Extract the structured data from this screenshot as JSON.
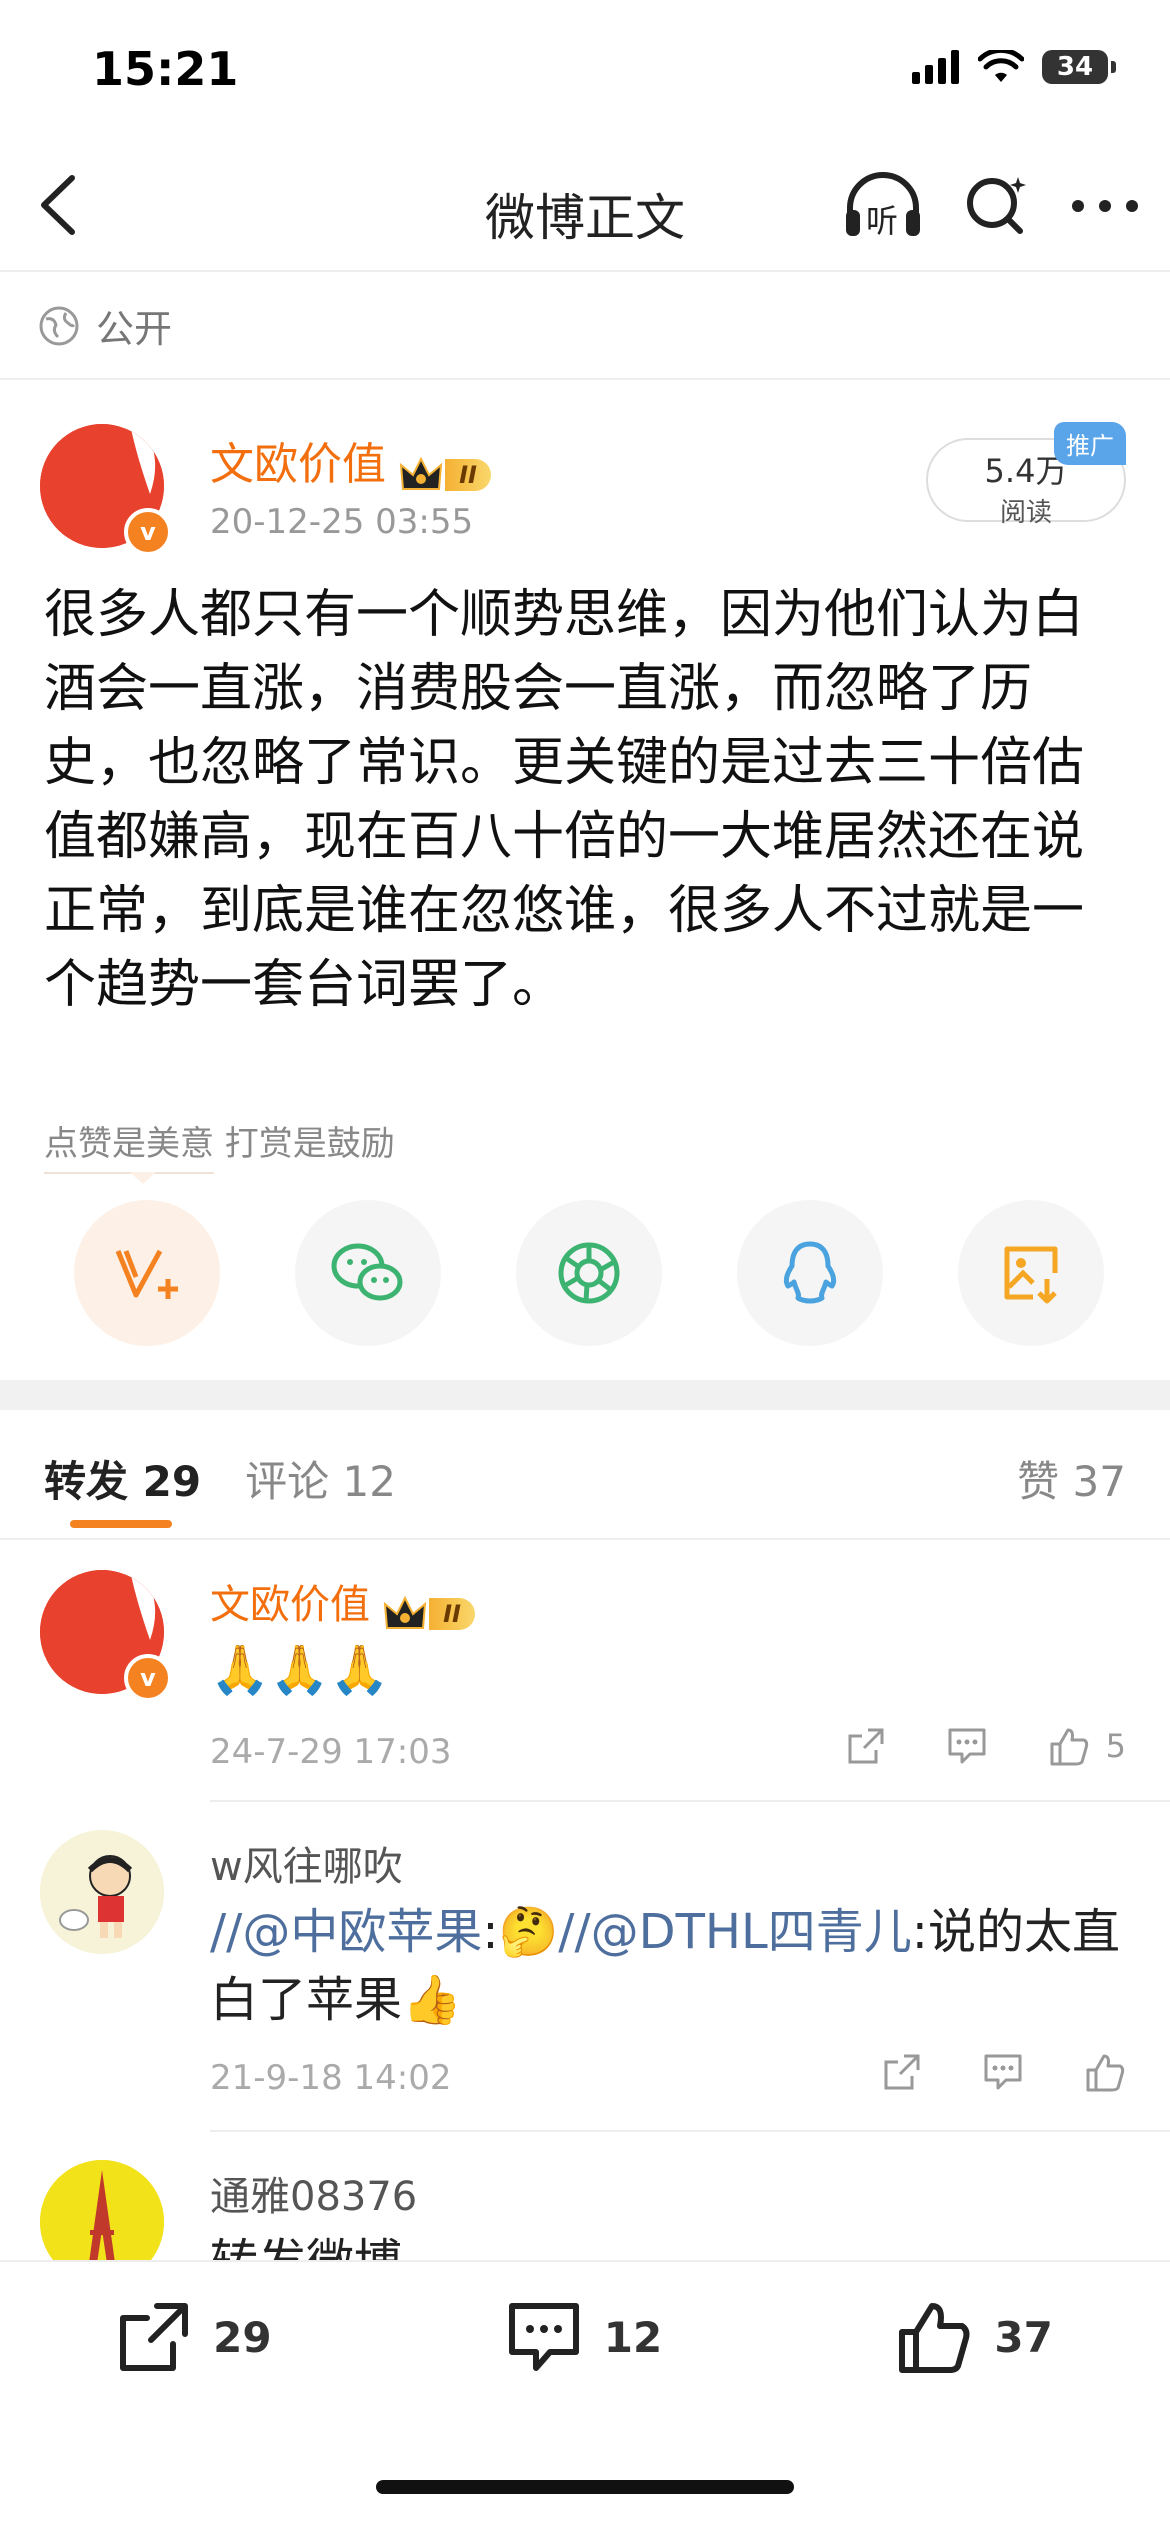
{
  "status": {
    "time": "15:21",
    "battery": "34"
  },
  "nav": {
    "title": "微博正文",
    "listen_label": "听"
  },
  "visibility": "公开",
  "post": {
    "author": "文欧价值",
    "level": "II",
    "timestamp": "20-12-25 03:55",
    "reads_count": "5.4万",
    "reads_label": "阅读",
    "promo_badge": "推广",
    "text": "很多人都只有一个顺势思维，因为他们认为白酒会一直涨，消费股会一直涨，而忽略了历史，也忽略了常识。更关键的是过去三十倍估值都嫌高，现在百八十倍的一大堆居然还在说正常，到底是谁在忽悠谁，很多人不过就是一个趋势一套台词罢了。"
  },
  "tip_text": "点赞是美意  打赏是鼓励",
  "share_icons": [
    "v-plus-reward-icon",
    "wechat-icon",
    "moments-icon",
    "qq-icon",
    "save-image-icon"
  ],
  "tabs": {
    "repost": {
      "label": "转发",
      "count": "29"
    },
    "comment": {
      "label": "评论",
      "count": "12"
    },
    "like": {
      "label": "赞",
      "count": "37"
    }
  },
  "reposts": [
    {
      "name": "文欧价值",
      "text": "🙏🙏🙏",
      "time": "24-7-29 17:03",
      "likes": "5"
    },
    {
      "name": "w风往哪吹",
      "mention1": "//@中欧苹果",
      "emoji1": "🤔",
      "mention2": "//@DTHL四青儿",
      "text_tail": ":说的太直白了苹果👍",
      "time": "21-9-18 14:02",
      "likes": ""
    },
    {
      "name": "通雅08376",
      "text": "转发微博"
    }
  ],
  "bottom_bar": {
    "repost": "29",
    "comment": "12",
    "like": "37"
  },
  "colors": {
    "accent": "#f58220",
    "username": "#f36f0e",
    "mention": "#4e6f9d"
  }
}
